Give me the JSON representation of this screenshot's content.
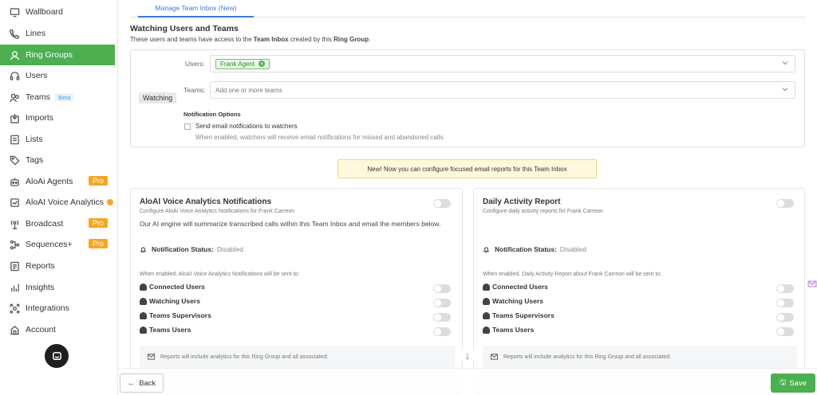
{
  "sidebar": {
    "items": [
      {
        "label": "Wallboard",
        "icon": "monitor-icon"
      },
      {
        "label": "Lines",
        "icon": "phone-icon"
      },
      {
        "label": "Ring Groups",
        "icon": "ring-group-icon",
        "active": true
      },
      {
        "label": "Users",
        "icon": "headset-icon"
      },
      {
        "label": "Teams",
        "icon": "team-icon",
        "badge": "Beta"
      },
      {
        "label": "Imports",
        "icon": "import-icon"
      },
      {
        "label": "Lists",
        "icon": "list-icon"
      },
      {
        "label": "Tags",
        "icon": "tag-icon"
      },
      {
        "label": "AloAi Agents",
        "icon": "robot-icon",
        "badge": "Pro"
      },
      {
        "label": "AloAI Voice Analytics",
        "icon": "analytics-icon",
        "dot": true
      },
      {
        "label": "Broadcast",
        "icon": "broadcast-icon",
        "badge": "Pro"
      },
      {
        "label": "Sequences+",
        "icon": "sequence-icon",
        "badge": "Pro"
      },
      {
        "label": "Reports",
        "icon": "report-icon"
      },
      {
        "label": "Insights",
        "icon": "insights-icon"
      },
      {
        "label": "Integrations",
        "icon": "integrations-icon"
      },
      {
        "label": "Account",
        "icon": "account-icon"
      }
    ]
  },
  "tab": {
    "label": "Manage Team Inbox (New)"
  },
  "watching": {
    "title": "Watching Users and Teams",
    "subtitle_pre": "These users and teams have access to the ",
    "subtitle_bold1": "Team Inbox",
    "subtitle_mid": " created by this ",
    "subtitle_bold2": "Ring Group",
    "subtitle_post": ".",
    "tag": "Watching",
    "users_label": "Users:",
    "user_chip": "Frank Agent",
    "teams_label": "Teams:",
    "teams_placeholder": "Add one or more teams",
    "notif_title": "Notification Options",
    "checkbox_label": "Send email notifications to watchers",
    "checkbox_help": "When enabled, watchers will receive email notifications for missed and abandoned calls."
  },
  "banner": "New! Now you can configure focused email reports for this Team Inbox",
  "cards": [
    {
      "title": "AloAI Voice Analytics Notifications",
      "subtitle": "Configure AloAi Voice Analytics Notifications for Frank Carreon",
      "desc": "Our AI engine will summarize transcribed calls within this Team Inbox and email the members below.",
      "status_label": "Notification Status:",
      "status_value": "Disabled",
      "sent_to": "When enabled, AloAI Voice Analytics Notifications will be sent to:",
      "rows": [
        "Connected Users",
        "Watching Users",
        "Teams Supervisors",
        "Teams Users"
      ],
      "info": "Reports will include analytics for this Ring Group and all associated:"
    },
    {
      "title": "Daily Activity Report",
      "subtitle": "Configure daily activity reports for Frank Carreon",
      "desc": "",
      "status_label": "Notification Status:",
      "status_value": "Disabled",
      "sent_to": "When enabled, Daily Activity Report about Frank Carreon will be sent to:",
      "rows": [
        "Connected Users",
        "Watching Users",
        "Teams Supervisors",
        "Teams Users"
      ],
      "info": "Reports will include analytics for this Ring Group and all associated:"
    }
  ],
  "buttons": {
    "back": "Back",
    "save": "Save"
  }
}
